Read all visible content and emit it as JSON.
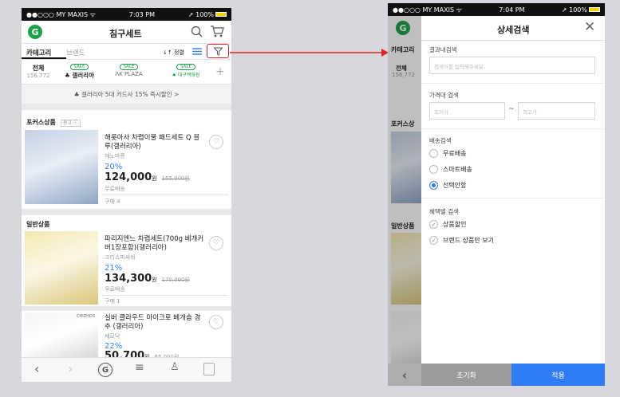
{
  "left": {
    "status": {
      "carrier": "●●○○○ MY MAXIS ᯤ",
      "time": "7:03 PM",
      "battery": "➚ 100%"
    },
    "header": {
      "logo": "G",
      "title": "침구세트"
    },
    "tabs": {
      "category": "카테고리",
      "brand": "브랜드",
      "sort": "↓↑ 정렬"
    },
    "brands": {
      "all_label": "전체",
      "all_count": "156,772",
      "sale": "SALE",
      "b1": "♣ 갤러리아",
      "b2": "ᐱK PLAZA",
      "b3": "♠ 대구백화점"
    },
    "promo": "♣ 갤러리아 5대 카드사 15% 즉시할인 >",
    "focus_section": {
      "title": "포커스상품",
      "badge": "광고 ⓘ"
    },
    "general_section": {
      "title": "일반상품"
    },
    "products": [
      {
        "name": "해롯아사 차렵이불 패드세트 Q 블루(갤러리아)",
        "seller": "헤노마롱",
        "discount": "20%",
        "price": "124,000",
        "won": "원",
        "orig": "155,000원",
        "ship": "무료배송",
        "buy": "구매 4"
      },
      {
        "name": "파리지엔느 차렵세트(700g 베개커버1장포함)(갤러리아)",
        "seller": "크리스피싸바",
        "discount": "21%",
        "price": "134,300",
        "won": "원",
        "orig": "170,000원",
        "ship": "무료배송",
        "buy": "구매 1"
      },
      {
        "name": "실버 클라우드 마이크로 베개솜 경추 (갤러리아)",
        "seller": "쎄모닥",
        "discount": "22%",
        "price": "50,700",
        "won": "원",
        "orig": "65,000원",
        "img_label": "CHIZHOS"
      }
    ]
  },
  "right": {
    "status": {
      "carrier": "●●○○○ MY MAXIS ᯤ",
      "time": "7:04 PM",
      "battery": "➚ 100%"
    },
    "behind": {
      "tab": "카테고리",
      "all_label": "전체",
      "all_count": "156,772",
      "focus": "포커스상",
      "general": "일반상품"
    },
    "panel": {
      "title": "상세검색",
      "result_search": {
        "label": "결과내검색",
        "placeholder": "검색어를 입력해주세요."
      },
      "price_search": {
        "label": "가격대 검색",
        "min_placeholder": "최저가",
        "max_placeholder": "최고가",
        "tilde": "~"
      },
      "shipping": {
        "label": "배송검색",
        "options": [
          "무료배송",
          "스마트배송",
          "선택안함"
        ],
        "selected": 2
      },
      "benefit": {
        "label": "혜택별 검색",
        "options": [
          "상품할인",
          "브랜드 상품만 보기"
        ]
      },
      "reset": "초기화",
      "apply": "적용"
    }
  },
  "colors": {
    "green": "#1aa34a",
    "blue": "#2e7cf6",
    "red": "#e02424",
    "reset_bg": "#9b9b9b"
  }
}
